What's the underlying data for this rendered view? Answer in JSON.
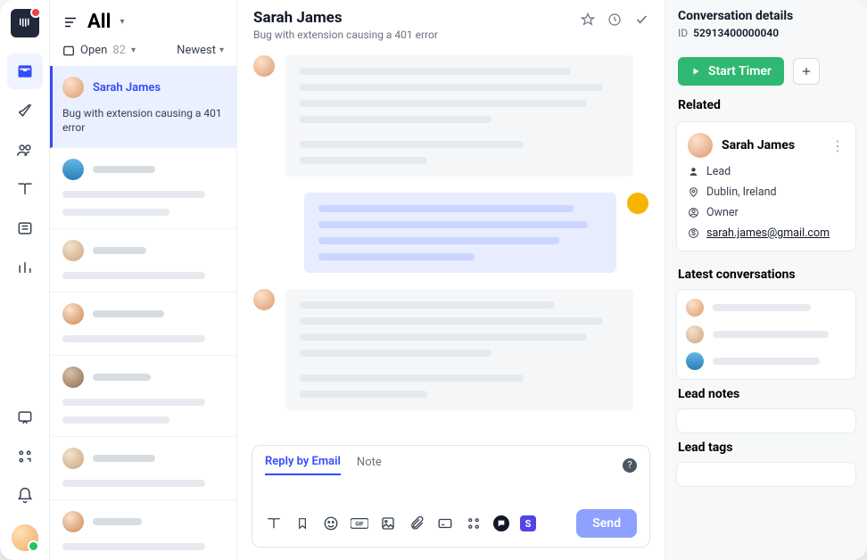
{
  "header": {
    "inbox_title": "All"
  },
  "filter": {
    "status": "Open",
    "count": "82",
    "sort": "Newest"
  },
  "selected_conv": {
    "name": "Sarah James",
    "subject": "Bug with extension causing a 401 error"
  },
  "thread": {
    "title": "Sarah James",
    "subtitle": "Bug with extension causing a 401 error"
  },
  "composer": {
    "tab_reply": "Reply by Email",
    "tab_note": "Note",
    "send": "Send"
  },
  "details": {
    "heading": "Conversation details",
    "id_label": "ID",
    "id_value": "52913400000040",
    "start_timer": "Start Timer",
    "related": "Related",
    "contact_name": "Sarah James",
    "role": "Lead",
    "location": "Dublin, Ireland",
    "owner": "Owner",
    "email": "sarah.james@gmail.com",
    "latest": "Latest conversations",
    "lead_notes": "Lead notes",
    "lead_tags": "Lead tags"
  }
}
